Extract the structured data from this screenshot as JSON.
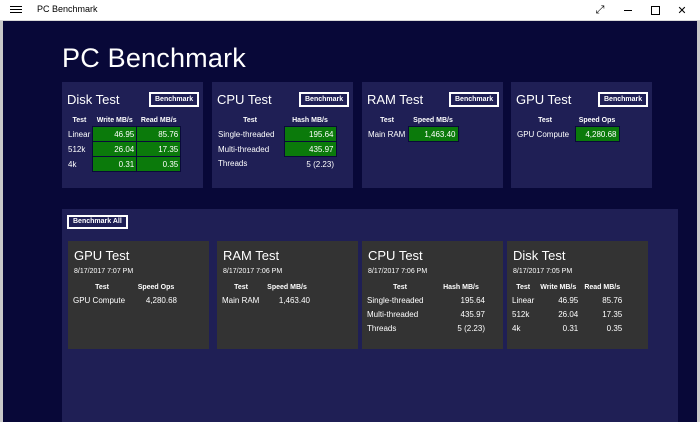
{
  "window": {
    "title": "PC Benchmark",
    "controls": {
      "expand": "⤢",
      "minimize": "",
      "maximize": "",
      "close": "✕"
    }
  },
  "page": {
    "title": "PC Benchmark"
  },
  "benchmark_label": "Benchmark",
  "benchmark_all_label": "Benchmark All",
  "cards": {
    "disk": {
      "title": "Disk Test",
      "headers": [
        "Test",
        "Write MB/s",
        "Read MB/s"
      ],
      "rows": [
        {
          "test": "Linear",
          "write": "46.95",
          "read": "85.76"
        },
        {
          "test": "512k",
          "write": "26.04",
          "read": "17.35"
        },
        {
          "test": "4k",
          "write": "0.31",
          "read": "0.35"
        }
      ]
    },
    "cpu": {
      "title": "CPU Test",
      "headers": [
        "Test",
        "Hash MB/s"
      ],
      "rows": [
        {
          "test": "Single-threaded",
          "value": "195.64"
        },
        {
          "test": "Multi-threaded",
          "value": "435.97"
        },
        {
          "test": "Threads",
          "value": "5 (2.23)"
        }
      ]
    },
    "ram": {
      "title": "RAM Test",
      "headers": [
        "Test",
        "Speed MB/s"
      ],
      "rows": [
        {
          "test": "Main RAM",
          "value": "1,463.40"
        }
      ]
    },
    "gpu": {
      "title": "GPU Test",
      "headers": [
        "Test",
        "Speed Ops"
      ],
      "rows": [
        {
          "test": "GPU Compute",
          "value": "4,280.68"
        }
      ]
    }
  },
  "results": {
    "gpu": {
      "title": "GPU Test",
      "date": "8/17/2017 7:07 PM",
      "headers": [
        "Test",
        "Speed Ops"
      ],
      "rows": [
        {
          "test": "GPU Compute",
          "value": "4,280.68"
        }
      ]
    },
    "ram": {
      "title": "RAM Test",
      "date": "8/17/2017 7:06 PM",
      "headers": [
        "Test",
        "Speed MB/s"
      ],
      "rows": [
        {
          "test": "Main RAM",
          "value": "1,463.40"
        }
      ]
    },
    "cpu": {
      "title": "CPU Test",
      "date": "8/17/2017 7:06 PM",
      "headers": [
        "Test",
        "Hash MB/s"
      ],
      "rows": [
        {
          "test": "Single-threaded",
          "value": "195.64"
        },
        {
          "test": "Multi-threaded",
          "value": "435.97"
        },
        {
          "test": "Threads",
          "value": "5 (2.23)"
        }
      ]
    },
    "disk": {
      "title": "Disk Test",
      "date": "8/17/2017 7:05 PM",
      "headers": [
        "Test",
        "Write MB/s",
        "Read MB/s"
      ],
      "rows": [
        {
          "test": "Linear",
          "write": "46.95",
          "read": "85.76"
        },
        {
          "test": "512k",
          "write": "26.04",
          "read": "17.35"
        },
        {
          "test": "4k",
          "write": "0.31",
          "read": "0.35"
        }
      ]
    }
  },
  "colors": {
    "background": "#080838",
    "card": "#1f1f55",
    "result_card": "#333333",
    "good": "#0b7a0b"
  }
}
